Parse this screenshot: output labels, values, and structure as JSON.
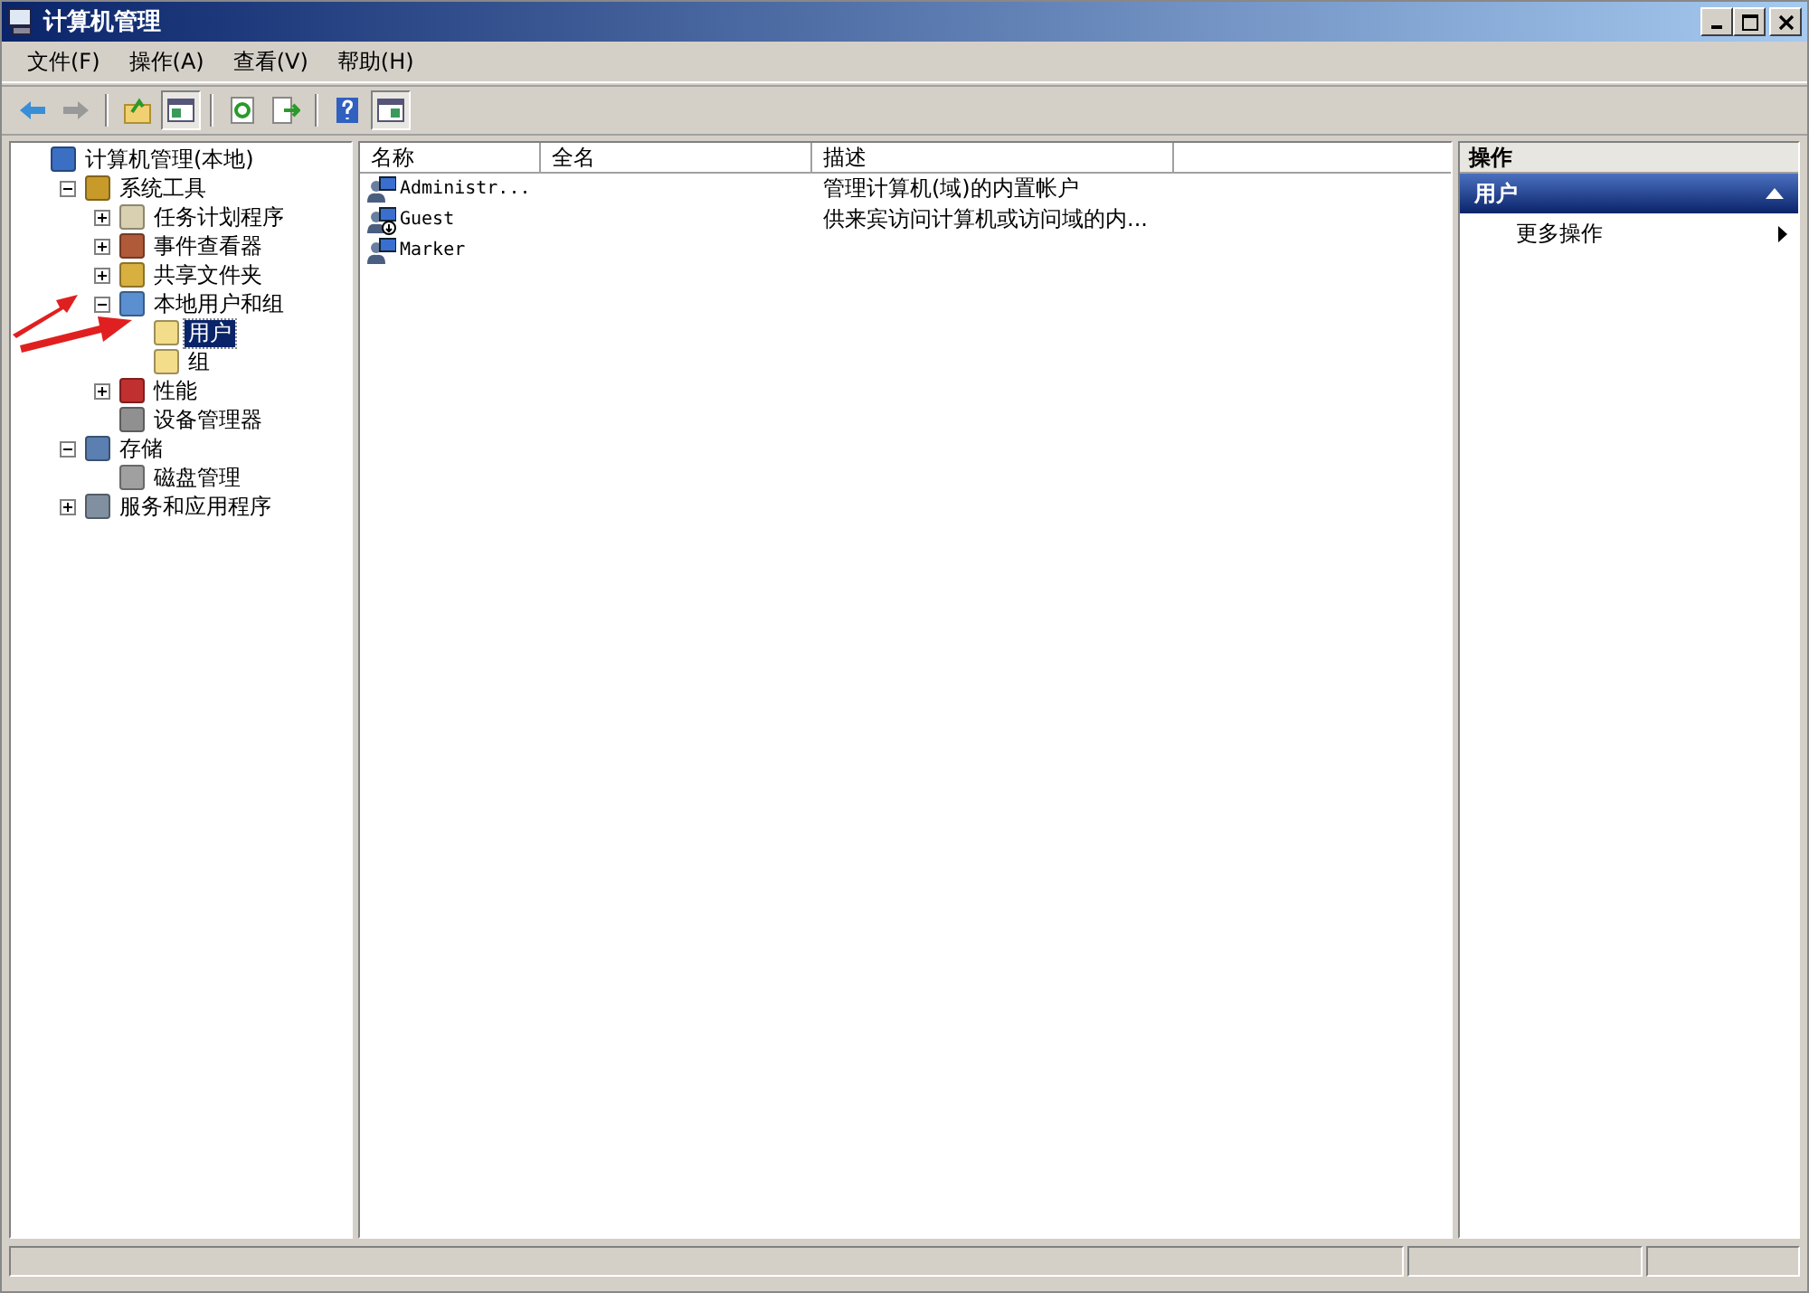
{
  "window": {
    "title": "计算机管理"
  },
  "menu": [
    "文件(F)",
    "操作(A)",
    "查看(V)",
    "帮助(H)"
  ],
  "toolbar": [
    {
      "kind": "back",
      "disabled": false
    },
    {
      "kind": "forward",
      "disabled": true
    },
    {
      "kind": "sep"
    },
    {
      "kind": "up"
    },
    {
      "kind": "pane",
      "pressed": true
    },
    {
      "kind": "sep"
    },
    {
      "kind": "refresh"
    },
    {
      "kind": "export"
    },
    {
      "kind": "sep"
    },
    {
      "kind": "help"
    },
    {
      "kind": "pane2",
      "pressed": true
    }
  ],
  "tree": [
    {
      "label": "计算机管理(本地)",
      "kind": "computer",
      "selected": false,
      "children": [
        {
          "label": "系统工具",
          "kind": "tools",
          "expanded": true,
          "selected": false,
          "children": [
            {
              "label": "任务计划程序",
              "kind": "clock",
              "expanded": false,
              "selected": false
            },
            {
              "label": "事件查看器",
              "kind": "event",
              "expanded": false,
              "selected": false
            },
            {
              "label": "共享文件夹",
              "kind": "share",
              "expanded": false,
              "selected": false
            },
            {
              "label": "本地用户和组",
              "kind": "users",
              "expanded": true,
              "selected": false,
              "children": [
                {
                  "label": "用户",
                  "kind": "folder",
                  "selected": true
                },
                {
                  "label": "组",
                  "kind": "folder",
                  "selected": false
                }
              ]
            },
            {
              "label": "性能",
              "kind": "perf",
              "expanded": false,
              "selected": false
            },
            {
              "label": "设备管理器",
              "kind": "device",
              "selected": false
            }
          ]
        },
        {
          "label": "存储",
          "kind": "storage",
          "expanded": true,
          "selected": false,
          "children": [
            {
              "label": "磁盘管理",
              "kind": "disk",
              "selected": false
            }
          ]
        },
        {
          "label": "服务和应用程序",
          "kind": "services",
          "expanded": false,
          "selected": false
        }
      ]
    }
  ],
  "list": {
    "columns": [
      "名称",
      "全名",
      "描述"
    ],
    "rows": [
      {
        "name": "Administr...",
        "full_name": "",
        "description": "管理计算机(域)的内置帐户",
        "disabled": false
      },
      {
        "name": "Guest",
        "description": "供来宾访问计算机或访问域的内...",
        "disabled": true
      },
      {
        "name": "Marker",
        "description": "",
        "disabled": false
      }
    ]
  },
  "actions": {
    "title": "操作",
    "section": "用户",
    "expanded": true,
    "items": [
      "更多操作"
    ]
  }
}
